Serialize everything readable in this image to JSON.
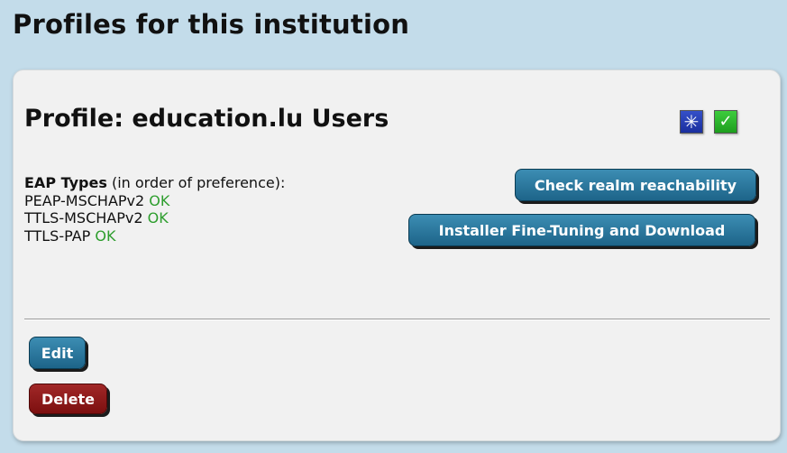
{
  "page": {
    "heading": "Profiles for this institution"
  },
  "profile": {
    "title": "Profile: education.lu Users",
    "status_icons": [
      {
        "name": "asterisk-icon",
        "glyph": "✳",
        "color": "#1f35b0"
      },
      {
        "name": "checkmark-icon",
        "glyph": "✓",
        "color": "#2fb82f"
      }
    ],
    "eap": {
      "label": "EAP Types",
      "note": " (in order of preference):",
      "types": [
        {
          "name": "PEAP-MSCHAPv2",
          "status": "OK"
        },
        {
          "name": "TTLS-MSCHAPv2",
          "status": "OK"
        },
        {
          "name": "TTLS-PAP",
          "status": "OK"
        }
      ]
    },
    "buttons": {
      "check_reachability": "Check realm reachability",
      "installer": "Installer Fine-Tuning and Download",
      "edit": "Edit",
      "delete": "Delete"
    }
  },
  "colors": {
    "background": "#c3dcea",
    "card": "#f1f1f1",
    "primary_button": "#1d6489",
    "danger_button": "#7c0f0f",
    "ok_text": "#2e9e2e"
  }
}
